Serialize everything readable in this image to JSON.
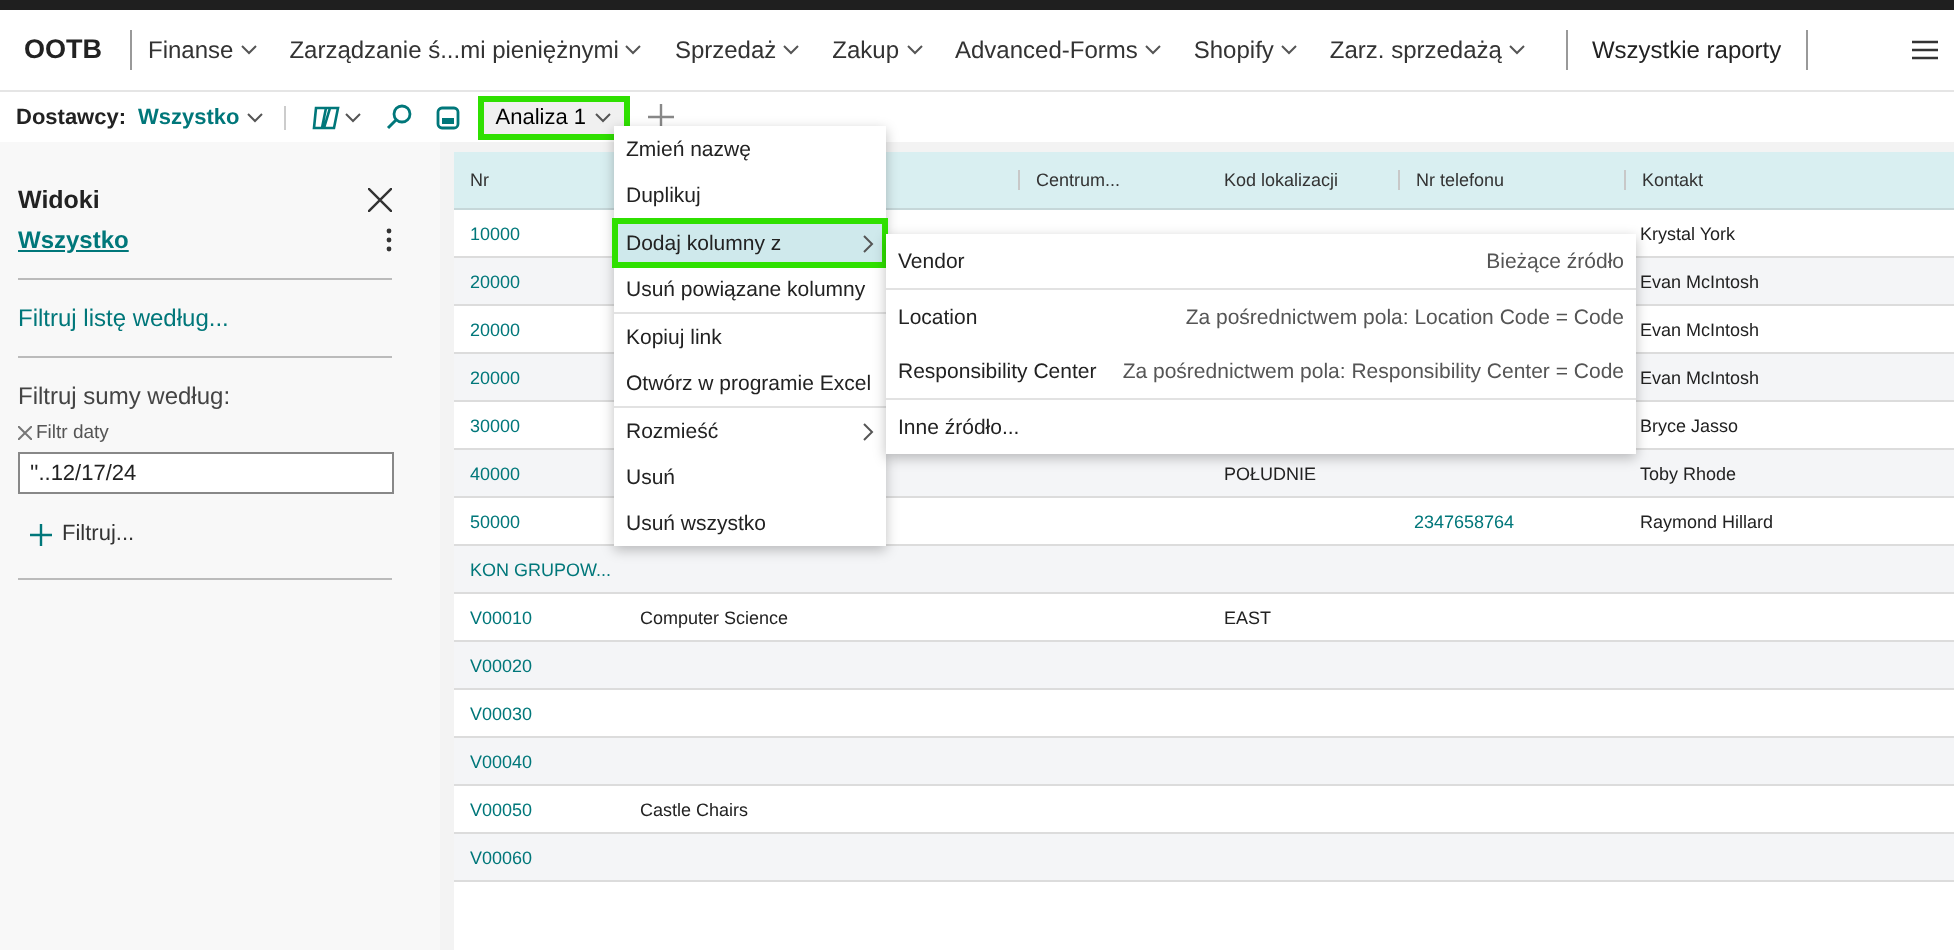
{
  "nav": {
    "brand": "OOTB",
    "items": [
      {
        "label": "Finanse"
      },
      {
        "label": "Zarządzanie ś...mi pieniężnymi"
      },
      {
        "label": "Sprzedaż"
      },
      {
        "label": "Zakup"
      },
      {
        "label": "Advanced-Forms"
      },
      {
        "label": "Shopify"
      },
      {
        "label": "Zarz. sprzedażą"
      }
    ],
    "reports": "Wszystkie raporty"
  },
  "toolbar": {
    "caption": "Dostawcy:",
    "view": "Wszystko",
    "analysis_tab": {
      "label": "Analiza 1",
      "highlighted": true
    }
  },
  "sidebar": {
    "title": "Widoki",
    "view": "Wszystko",
    "filter_list": "Filtruj listę według...",
    "filter_totals": "Filtruj sumy według:",
    "date_filter": {
      "label": "Filtr daty",
      "value": "''..12/17/24"
    },
    "add_filter": "Filtruj..."
  },
  "table": {
    "columns": {
      "nr": "Nr",
      "centrum": "Centrum...",
      "kod_lokalizacji": "Kod lokalizacji",
      "nr_telefonu": "Nr telefonu",
      "kontakt": "Kontakt"
    },
    "rows": [
      {
        "nr": "10000",
        "kontakt": "Krystal York"
      },
      {
        "nr": "20000",
        "kontakt": "Evan McIntosh"
      },
      {
        "nr": "20000",
        "kontakt": "Evan McIntosh"
      },
      {
        "nr": "20000",
        "kontakt": "Evan McIntosh"
      },
      {
        "nr": "30000",
        "kontakt": "Bryce Jasso"
      },
      {
        "nr": "40000",
        "kod_lokalizacji": "POŁUDNIE",
        "kontakt": "Toby Rhode"
      },
      {
        "nr": "50000",
        "nr_telefonu": "2347658764",
        "kontakt": "Raymond Hillard"
      },
      {
        "nr": "KON GRUPOW..."
      },
      {
        "nr": "V00010",
        "column_2": "Computer Science",
        "kod_lokalizacji": "EAST"
      },
      {
        "nr": "V00020"
      },
      {
        "nr": "V00030"
      },
      {
        "nr": "V00040"
      },
      {
        "nr": "V00050",
        "column_2": "Castle Chairs"
      },
      {
        "nr": "V00060"
      }
    ]
  },
  "context_menu": {
    "groups": [
      [
        {
          "label": "Zmień nazwę",
          "kind": "action",
          "selected": false,
          "highlighted": false
        },
        {
          "label": "Duplikuj",
          "kind": "action",
          "selected": false,
          "highlighted": false
        }
      ],
      [
        {
          "label": "Dodaj kolumny z",
          "kind": "submenu",
          "selected": true,
          "highlighted": true
        },
        {
          "label": "Usuń powiązane kolumny",
          "kind": "action",
          "selected": false,
          "highlighted": false
        }
      ],
      [
        {
          "label": "Kopiuj link",
          "kind": "action",
          "selected": false,
          "highlighted": false
        },
        {
          "label": "Otwórz w programie Excel",
          "kind": "action",
          "selected": false,
          "highlighted": false
        }
      ],
      [
        {
          "label": "Rozmieść",
          "kind": "submenu",
          "selected": false,
          "highlighted": false
        },
        {
          "label": "Usuń",
          "kind": "action",
          "selected": false,
          "highlighted": false
        },
        {
          "label": "Usuń wszystko",
          "kind": "action",
          "selected": false,
          "highlighted": false
        }
      ]
    ]
  },
  "submenu": {
    "groups": [
      [
        {
          "label": "Vendor",
          "detail": "Bieżące źródło"
        }
      ],
      [
        {
          "label": "Location",
          "detail": "Za pośrednictwem pola: Location Code = Code"
        },
        {
          "label": "Responsibility Center",
          "detail": "Za pośrednictwem pola: Responsibility Center = Code"
        }
      ],
      [
        {
          "label": "Inne źródło..."
        }
      ]
    ]
  }
}
